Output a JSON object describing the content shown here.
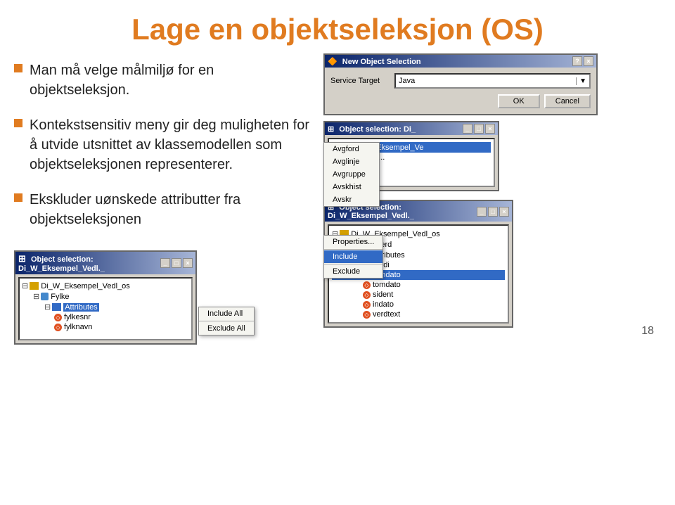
{
  "page": {
    "title": "Lage en objektseleksjon (OS)",
    "page_number": "18"
  },
  "bullets": [
    {
      "id": "bullet1",
      "text": "Man må velge målmiljø for en objektseleksjon."
    },
    {
      "id": "bullet2",
      "text": "Kontekstsensitiv meny gir deg muligheten for å utvide utsnittet av klassemodellen som objektseleksjonen representerer."
    },
    {
      "id": "bullet3",
      "text": "Ekskluder uønskede attributter fra objektseleksjonen"
    }
  ],
  "dialog_nos": {
    "title": "New Object Selection",
    "label": "Service Target",
    "dropdown_value": "Java",
    "ok_label": "OK",
    "cancel_label": "Cancel"
  },
  "dialog_os1": {
    "title": "Object selection: Di_",
    "tree_items": [
      "Di_W_Eksempel_Ve"
    ]
  },
  "context_menu_top": {
    "items": [
      "Avgford",
      "Avglinje",
      "Avgruppe",
      "Avskhist",
      "Avskr"
    ]
  },
  "dialog_os2": {
    "title": "Object selection: Di_W_Eksempel_Vedl._",
    "tree": {
      "root": "Di_W_Eksempel_Vedl_os",
      "children": [
        {
          "name": "Gyldverd",
          "children": [
            {
              "name": "Attributes",
              "children": [
                "verdi",
                "fomdato",
                "tomdato",
                "sident",
                "indato",
                "verdtext"
              ]
            }
          ]
        }
      ]
    }
  },
  "context_menu_right": {
    "items": [
      "Properties...",
      "Include",
      "Exclude"
    ]
  },
  "dialog_os3": {
    "title": "Object selection: Di_W_Eksempel_Vedl._",
    "tree": {
      "root": "Di_W_Eksempel_Vedl_os",
      "children": [
        {
          "name": "Fylke",
          "children": [
            {
              "name": "Attributes",
              "highlight": true,
              "children": [
                "fylkesnr",
                "fylknavn"
              ]
            }
          ]
        }
      ]
    }
  },
  "context_menu_bottom": {
    "items": [
      "Include All",
      "Exclude All"
    ]
  }
}
